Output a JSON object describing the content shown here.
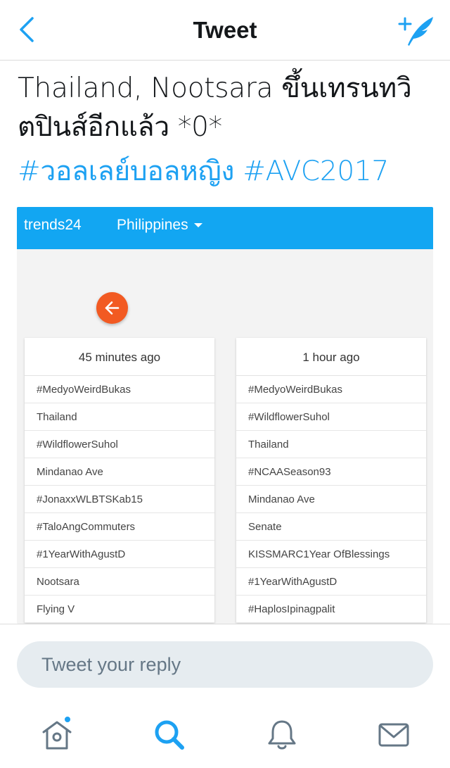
{
  "nav": {
    "title": "Tweet",
    "back_icon": "chevron-left-icon",
    "compose_icon": "compose-tweet-icon",
    "accent_color": "#1da1f2"
  },
  "tweet": {
    "line1": "Thailand, Nootsara ขึ้นเทรนทวิ",
    "line2": "ตปินส์อีกแล้ว *0*",
    "hashtags": [
      "#วอลเลย์บอลหญิง",
      "#AVC2017"
    ]
  },
  "media": {
    "brand": "trends24",
    "country": "Philippines",
    "header_color": "#12a6f2",
    "back_button_color": "#f25a22",
    "columns": [
      {
        "time": "45 minutes ago",
        "trends": [
          "#MedyoWeirdBukas",
          "Thailand",
          "#WildflowerSuhol",
          "Mindanao Ave",
          "#JonaxxWLBTSKab15",
          "#TaloAngCommuters",
          "#1YearWithAgustD",
          "Nootsara",
          "Flying V"
        ]
      },
      {
        "time": "1 hour ago",
        "trends": [
          "#MedyoWeirdBukas",
          "#WildflowerSuhol",
          "Thailand",
          "#NCAASeason93",
          "Mindanao Ave",
          "Senate",
          "KISSMARC1Year OfBlessings",
          "#1YearWithAgustD",
          "#HaplosIpinagpalit"
        ]
      }
    ]
  },
  "reply": {
    "placeholder": "Tweet your reply"
  },
  "tabbar": {
    "items": [
      {
        "icon": "home-icon",
        "has_notification_dot": true
      },
      {
        "icon": "search-icon",
        "active": true
      },
      {
        "icon": "bell-icon"
      },
      {
        "icon": "envelope-icon"
      }
    ]
  }
}
